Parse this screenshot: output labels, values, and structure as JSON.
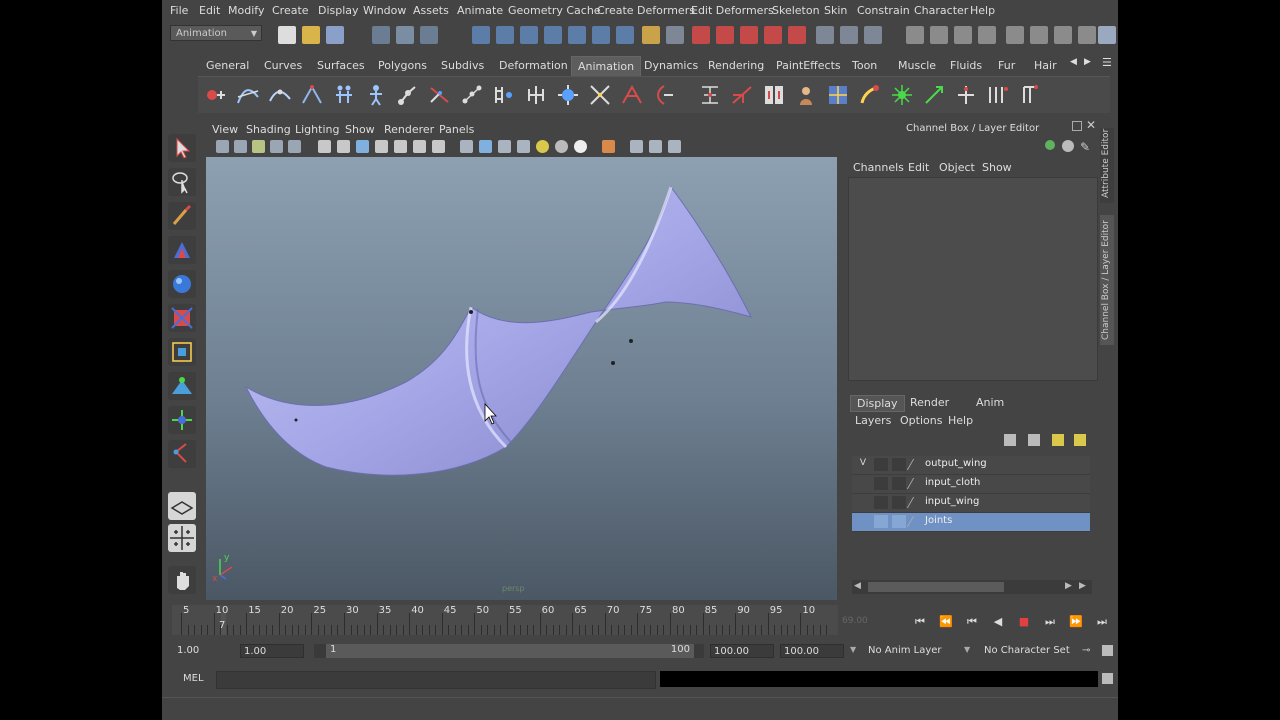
{
  "menu": [
    "File",
    "Edit",
    "Modify",
    "Create",
    "Display",
    "Window",
    "Assets",
    "Animate",
    "Geometry Cache",
    "Create Deformers",
    "Edit Deformers",
    "Skeleton",
    "Skin",
    "Constrain",
    "Character",
    "Help"
  ],
  "mode_selector": "Animation",
  "shelf_tabs": [
    "General",
    "Curves",
    "Surfaces",
    "Polygons",
    "Subdivs",
    "Deformation",
    "Animation",
    "Dynamics",
    "Rendering",
    "PaintEffects",
    "Toon",
    "Muscle",
    "Fluids",
    "Fur",
    "Hair"
  ],
  "active_shelf_tab": "Animation",
  "panel_menu": [
    "View",
    "Shading",
    "Lighting",
    "Show",
    "Renderer",
    "Panels"
  ],
  "channel_box": {
    "title": "Channel Box / Layer Editor",
    "menu": [
      "Channels",
      "Edit",
      "Object",
      "Show"
    ],
    "side_tabs": [
      "Attribute Editor",
      "Channel Box / Layer Editor"
    ]
  },
  "layer_editor": {
    "tabs": [
      "Display",
      "Render",
      "Anim"
    ],
    "active_tab": "Display",
    "menu": [
      "Layers",
      "Options",
      "Help"
    ],
    "layers": [
      {
        "visible": "V",
        "name": "output_wing",
        "selected": false
      },
      {
        "visible": "",
        "name": "input_cloth",
        "selected": false
      },
      {
        "visible": "",
        "name": "input_wing",
        "selected": false
      },
      {
        "visible": "",
        "name": "Joints",
        "selected": true
      }
    ]
  },
  "timeline": {
    "labels": [
      "5",
      "10",
      "15",
      "20",
      "25",
      "30",
      "35",
      "40",
      "45",
      "50",
      "55",
      "60",
      "65",
      "70",
      "75",
      "80",
      "85",
      "90",
      "95",
      "10"
    ],
    "current_frame": "7",
    "current_time_field": "69.00"
  },
  "range": {
    "start": "1.00",
    "playback_start": "1.00",
    "slider_left": "1",
    "slider_right": "100",
    "playback_end": "100.00",
    "end": "100.00",
    "anim_layer": "No Anim Layer",
    "character_set": "No Character Set"
  },
  "command_line": {
    "label": "MEL"
  },
  "viewport": {
    "axis_y": "y",
    "axis_x": "x",
    "camera_label": "persp"
  },
  "colors": {
    "layer_selected": "#6f91c4",
    "mesh": "#a6a8e8",
    "active_tab": "#5d5d5d"
  }
}
